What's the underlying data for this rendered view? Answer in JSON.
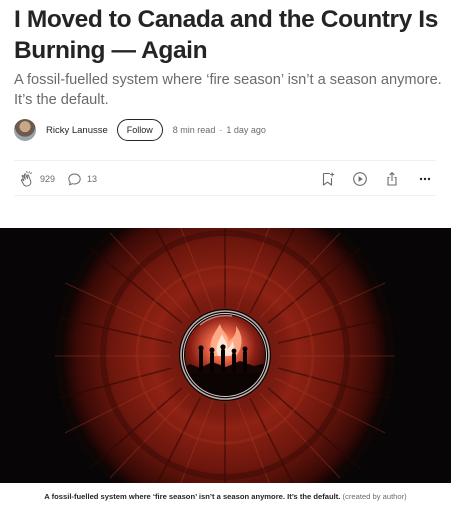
{
  "article": {
    "title": "I Moved to Canada and the Country Is Burning — Again",
    "subtitle": "A fossil-fuelled system where ‘fire season’ isn’t a season anymore. It’s the default."
  },
  "byline": {
    "author": "Ricky Lanusse",
    "follow_label": "Follow",
    "read_time": "8 min read",
    "separator": "·",
    "published": "1 day ago"
  },
  "actions": {
    "claps": "929",
    "responses": "13",
    "icons": [
      "clap-icon",
      "comment-icon",
      "bookmark-icon",
      "play-icon",
      "share-icon",
      "more-icon"
    ]
  },
  "image": {
    "caption_bold": "A fossil-fuelled system where ‘fire season’ isn’t a season anymore. It’s the default.",
    "caption_credit": "(created by author)"
  },
  "colors": {
    "text": "#242424",
    "muted": "#6b6b6b",
    "iris": "#8b1a10",
    "fire": "#e0533a"
  }
}
